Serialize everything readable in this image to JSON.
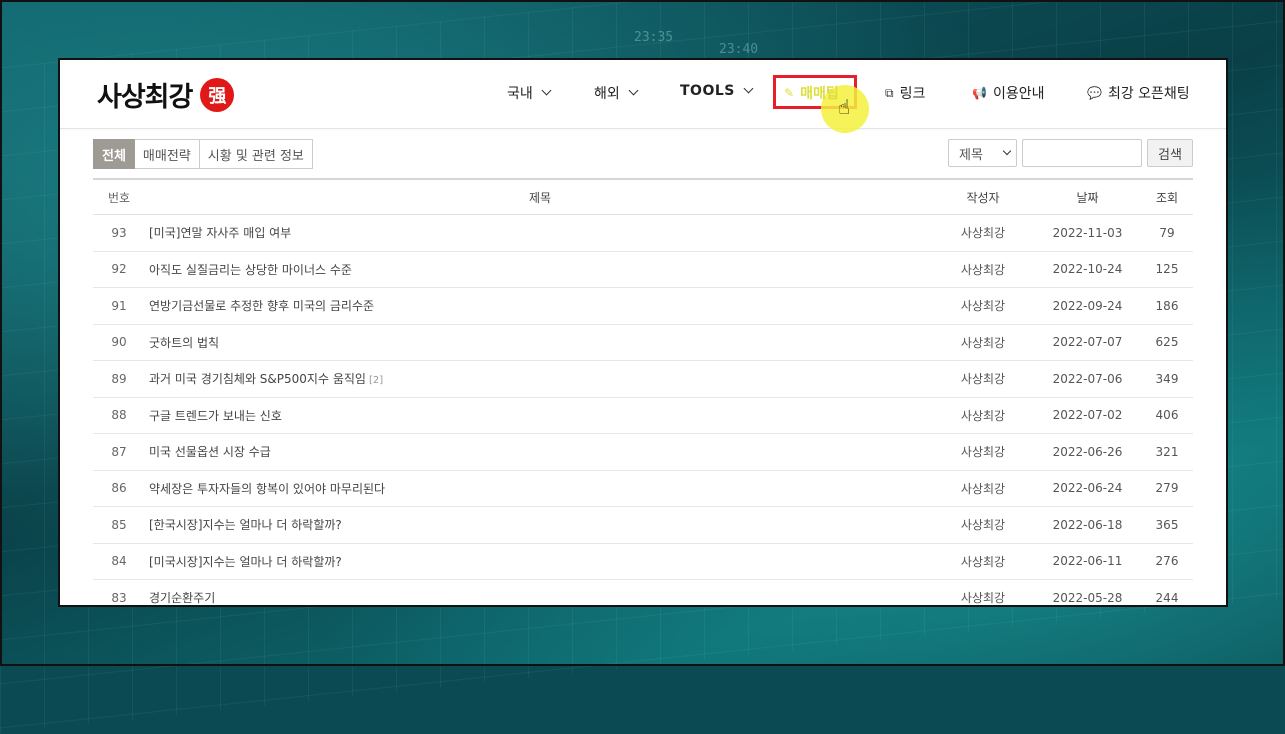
{
  "site": {
    "logo_text": "사상최강",
    "logo_seal": "强"
  },
  "nav": {
    "domestic": "국내",
    "overseas": "해외",
    "tools": "TOOLS",
    "trade_tip": "매매팁",
    "links": "링크",
    "guide": "이용안내",
    "open_chat": "최강 오픈채팅"
  },
  "categories": [
    "전체",
    "매매전략",
    "시황 및 관련 정보"
  ],
  "search": {
    "field_selected": "제목",
    "input_value": "",
    "button": "검색"
  },
  "table": {
    "headers": {
      "no": "번호",
      "title": "제목",
      "author": "작성자",
      "date": "날짜",
      "views": "조회"
    },
    "rows": [
      {
        "no": "93",
        "title": "[미국]연말 자사주 매입 여부",
        "comments": "",
        "author": "사상최강",
        "date": "2022-11-03",
        "views": "79"
      },
      {
        "no": "92",
        "title": "아직도 실질금리는 상당한 마이너스 수준",
        "comments": "",
        "author": "사상최강",
        "date": "2022-10-24",
        "views": "125"
      },
      {
        "no": "91",
        "title": "연방기금선물로 추정한 향후 미국의 금리수준",
        "comments": "",
        "author": "사상최강",
        "date": "2022-09-24",
        "views": "186"
      },
      {
        "no": "90",
        "title": "굿하트의 법칙",
        "comments": "",
        "author": "사상최강",
        "date": "2022-07-07",
        "views": "625"
      },
      {
        "no": "89",
        "title": "과거 미국 경기침체와 S&P500지수 움직임",
        "comments": "[2]",
        "author": "사상최강",
        "date": "2022-07-06",
        "views": "349"
      },
      {
        "no": "88",
        "title": "구글 트렌드가 보내는 신호",
        "comments": "",
        "author": "사상최강",
        "date": "2022-07-02",
        "views": "406"
      },
      {
        "no": "87",
        "title": "미국 선물옵션 시장 수급",
        "comments": "",
        "author": "사상최강",
        "date": "2022-06-26",
        "views": "321"
      },
      {
        "no": "86",
        "title": "약세장은 투자자들의 항복이 있어야 마무리된다",
        "comments": "",
        "author": "사상최강",
        "date": "2022-06-24",
        "views": "279"
      },
      {
        "no": "85",
        "title": "[한국시장]지수는 얼마나 더 하락할까?",
        "comments": "",
        "author": "사상최강",
        "date": "2022-06-18",
        "views": "365"
      },
      {
        "no": "84",
        "title": "[미국시장]지수는 얼마나 더 하락할까?",
        "comments": "",
        "author": "사상최강",
        "date": "2022-06-11",
        "views": "276"
      },
      {
        "no": "83",
        "title": "경기순환주기",
        "comments": "",
        "author": "사상최강",
        "date": "2022-05-28",
        "views": "244"
      }
    ]
  },
  "background_text": [
    "23:35",
    "23:40"
  ],
  "colors": {
    "accent_red": "#e01818",
    "highlight_box": "#e81e2a",
    "active_tab": "#9e9b94",
    "cursor_glow": "#f5f03c"
  }
}
